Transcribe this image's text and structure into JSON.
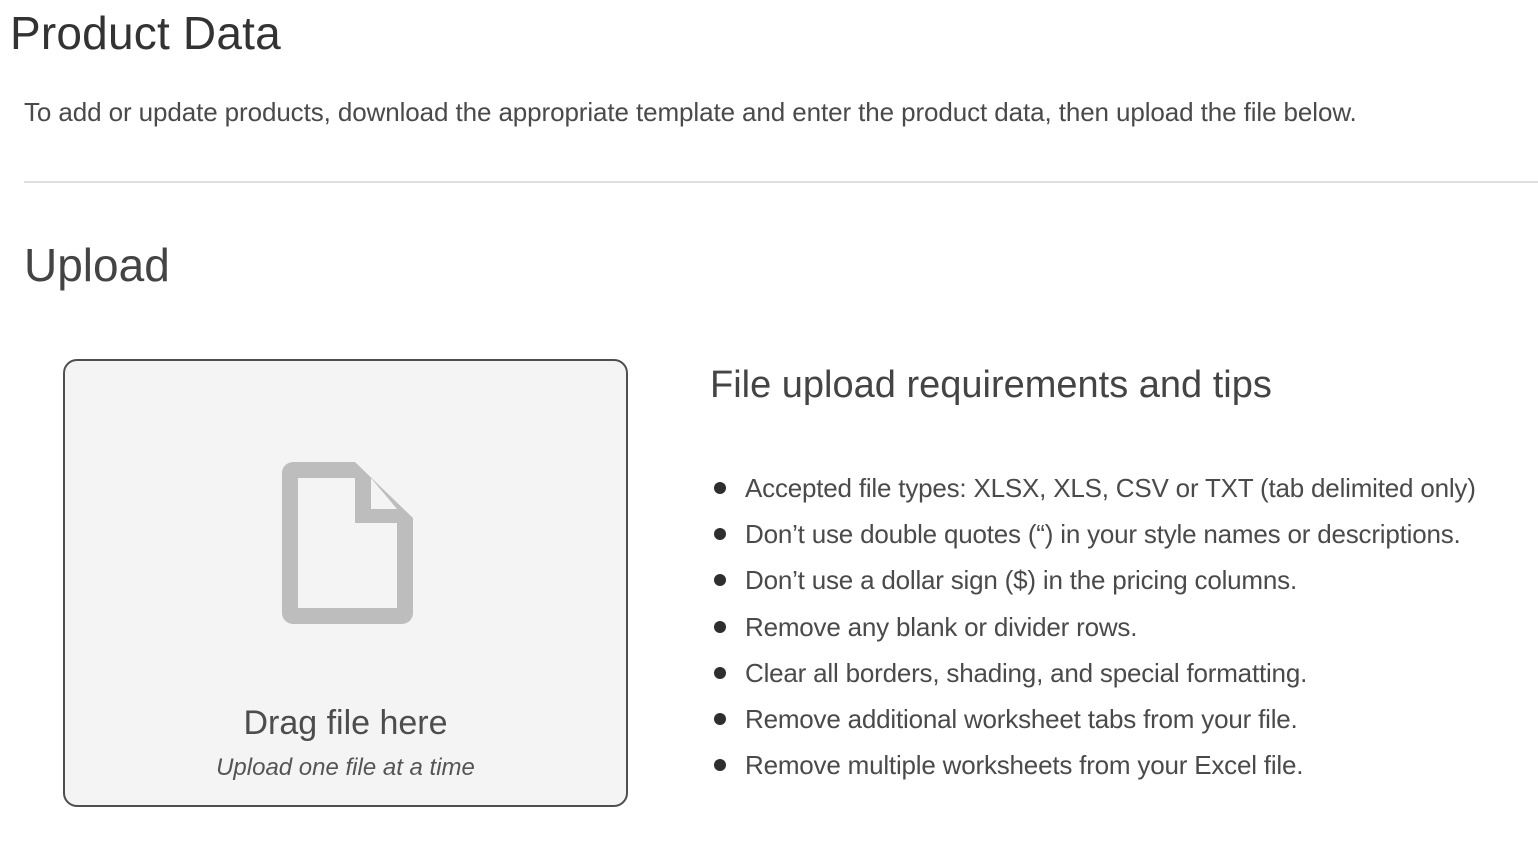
{
  "header": {
    "title": "Product Data",
    "intro": "To add or update products, download the appropriate template and enter the product data, then upload the file below."
  },
  "upload": {
    "section_title": "Upload",
    "dropzone": {
      "icon": "file-icon",
      "title": "Drag file here",
      "subtitle": "Upload one file at a time"
    },
    "tips": {
      "title": "File upload requirements and tips",
      "items": [
        "Accepted file types: XLSX, XLS, CSV or TXT (tab delimited only)",
        "Don’t use double quotes (“) in your style names or descriptions.",
        "Don’t use a dollar sign ($) in the pricing columns.",
        "Remove any blank or divider rows.",
        "Clear all borders, shading, and special formatting.",
        "Remove additional worksheet tabs from your file.",
        "Remove multiple worksheets from your Excel file."
      ]
    }
  },
  "colors": {
    "dropzone_bg": "#f4f4f4",
    "dropzone_border": "#4f4f4f",
    "icon_gray": "#bdbdbd",
    "text": "#4a4a4a"
  }
}
